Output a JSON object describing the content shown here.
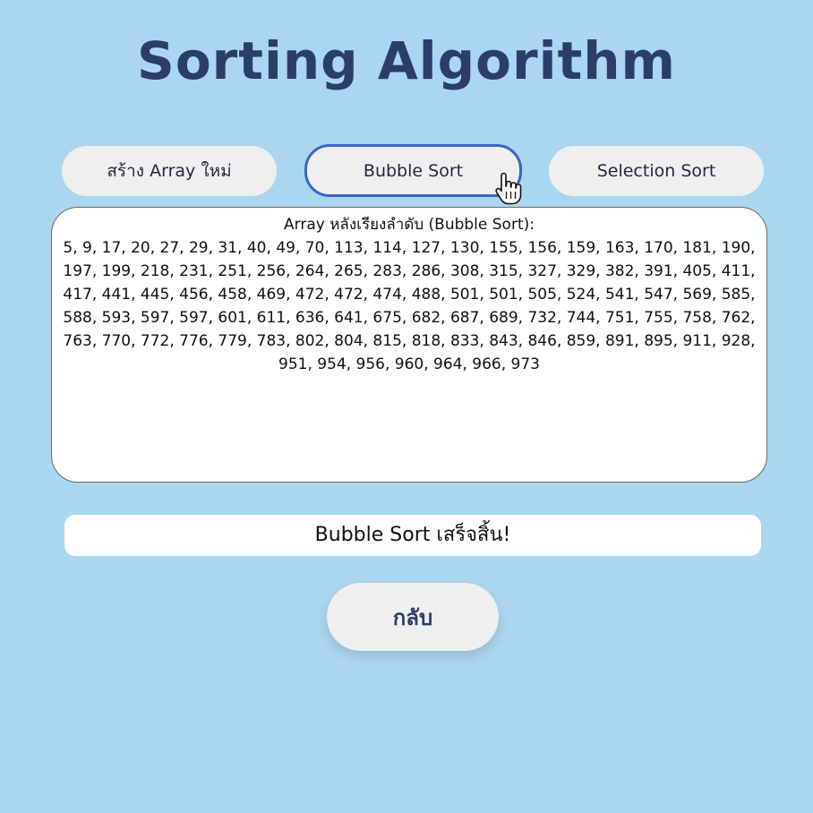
{
  "page": {
    "title": "Sorting Algorithm",
    "background_color": "#abd6ef",
    "title_color": "#2c3e66"
  },
  "controls": {
    "create_array_label": "สร้าง Array ใหม่",
    "bubble_sort_label": "Bubble Sort",
    "selection_sort_label": "Selection Sort",
    "active_border_color": "#3a64c6"
  },
  "output": {
    "heading": "Array หลังเรียงลำดับ (Bubble Sort):",
    "values": "5, 9, 17, 20, 27, 29, 31, 40, 49, 70, 113, 114, 127, 130, 155, 156, 159, 163, 170, 181, 190, 197, 199, 218, 231, 251, 256, 264, 265, 283, 286, 308, 315, 327, 329, 382, 391, 405, 411, 417, 441, 445, 456, 458, 469, 472, 472, 474, 488, 501, 501, 505, 524, 541, 547, 569, 585, 588, 593, 597, 597, 601, 611, 636, 641, 675, 682, 687, 689, 732, 744, 751, 755, 758, 762, 763, 770, 772, 776, 779, 783, 802, 804, 815, 818, 833, 843, 846, 859, 891, 895, 911, 928, 951, 954, 956, 960, 964, 966, 973"
  },
  "status": {
    "message": "Bubble Sort เสร็จสิ้น!"
  },
  "back_button": {
    "label": "กลับ"
  },
  "icons": {
    "cursor": "hand-pointer-icon"
  }
}
